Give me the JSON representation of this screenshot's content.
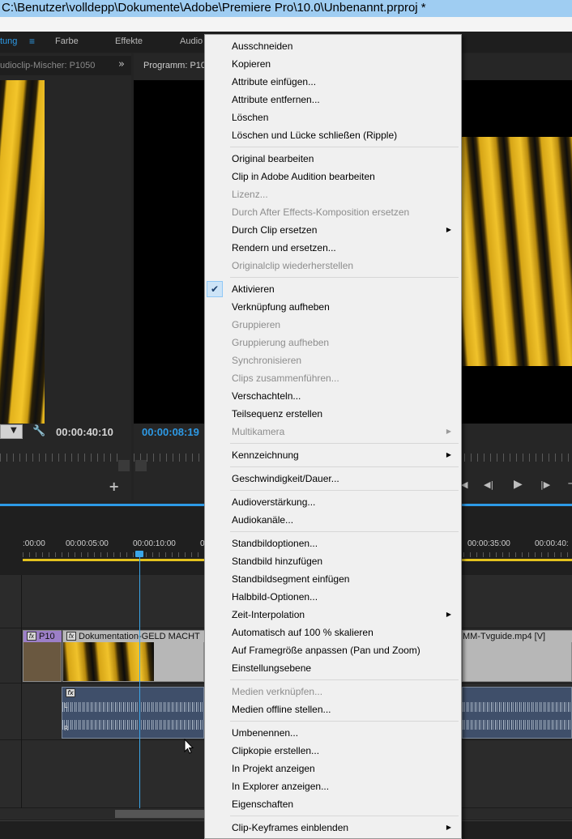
{
  "window": {
    "title": "C:\\Benutzer\\volldepp\\Dokumente\\Adobe\\Premiere Pro\\10.0\\Unbenannt.prproj *"
  },
  "workspaces": {
    "active": "tung",
    "menu_glyph": "≡",
    "items": [
      "Farbe",
      "Effekte",
      "Audio"
    ]
  },
  "source_panel": {
    "tab": "udioclip-Mischer: P1050",
    "overflow": "»",
    "timecode": "00:00:40:10",
    "dropdown": "▼",
    "wrench": "🔧",
    "add": "+"
  },
  "program_panel": {
    "tab": "Programm: P10",
    "timecode": "00:00:08:19",
    "transport": [
      "◀",
      "◀|",
      "▶",
      "|▶",
      "−"
    ]
  },
  "timeline": {
    "ruler_labels": [
      ":00:00",
      "00:00:05:00",
      "00:00:10:00",
      "0",
      "00:00:35:00",
      "00:00:40:"
    ],
    "clips": {
      "v1_a": "P10",
      "v1_b": "Dokumentation-GELD MACHT",
      "v1_c": "MM-Tvguide.mp4 [V]",
      "fx": "fx",
      "a_ch_l": "L",
      "a_ch_r": "R"
    }
  },
  "context_menu": {
    "items": [
      {
        "label": "Ausschneiden"
      },
      {
        "label": "Kopieren"
      },
      {
        "label": "Attribute einfügen..."
      },
      {
        "label": "Attribute entfernen..."
      },
      {
        "label": "Löschen"
      },
      {
        "label": "Löschen und Lücke schließen (Ripple)"
      },
      {
        "separator": true
      },
      {
        "label": "Original bearbeiten"
      },
      {
        "label": "Clip in Adobe Audition bearbeiten"
      },
      {
        "label": "Lizenz...",
        "disabled": true
      },
      {
        "label": "Durch After Effects-Komposition ersetzen",
        "disabled": true
      },
      {
        "label": "Durch Clip ersetzen",
        "submenu": true
      },
      {
        "label": "Rendern und ersetzen..."
      },
      {
        "label": "Originalclip wiederherstellen",
        "disabled": true
      },
      {
        "separator": true
      },
      {
        "label": "Aktivieren",
        "checked": true
      },
      {
        "label": "Verknüpfung aufheben"
      },
      {
        "label": "Gruppieren",
        "disabled": true
      },
      {
        "label": "Gruppierung aufheben",
        "disabled": true
      },
      {
        "label": "Synchronisieren",
        "disabled": true
      },
      {
        "label": "Clips zusammenführen...",
        "disabled": true
      },
      {
        "label": "Verschachteln..."
      },
      {
        "label": "Teilsequenz erstellen"
      },
      {
        "label": "Multikamera",
        "disabled": true,
        "submenu": true
      },
      {
        "separator": true
      },
      {
        "label": "Kennzeichnung",
        "submenu": true
      },
      {
        "separator": true
      },
      {
        "label": "Geschwindigkeit/Dauer..."
      },
      {
        "separator": true
      },
      {
        "label": "Audioverstärkung..."
      },
      {
        "label": "Audiokanäle..."
      },
      {
        "separator": true
      },
      {
        "label": "Standbildoptionen..."
      },
      {
        "label": "Standbild hinzufügen"
      },
      {
        "label": "Standbildsegment einfügen"
      },
      {
        "label": "Halbbild-Optionen..."
      },
      {
        "label": "Zeit-Interpolation",
        "submenu": true
      },
      {
        "label": "Automatisch auf 100 % skalieren"
      },
      {
        "label": "Auf Framegröße anpassen (Pan und Zoom)"
      },
      {
        "label": "Einstellungsebene"
      },
      {
        "separator": true
      },
      {
        "label": "Medien verknüpfen...",
        "disabled": true
      },
      {
        "label": "Medien offline stellen..."
      },
      {
        "separator": true
      },
      {
        "label": "Umbenennen..."
      },
      {
        "label": "Clipkopie erstellen..."
      },
      {
        "label": "In Projekt anzeigen"
      },
      {
        "label": "In Explorer anzeigen..."
      },
      {
        "label": "Eigenschaften"
      },
      {
        "separator": true
      },
      {
        "label": "Clip-Keyframes einblenden",
        "submenu": true
      }
    ],
    "check_glyph": "✔",
    "submenu_glyph": "▶"
  }
}
